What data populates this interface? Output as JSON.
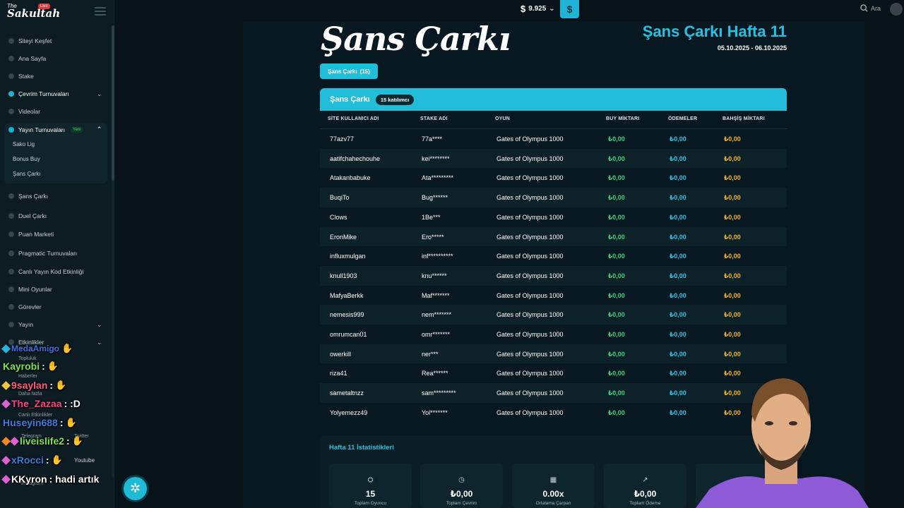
{
  "brand": {
    "top": "The",
    "name": "Sakultah",
    "live_badge": "Live"
  },
  "topbar": {
    "currency_symbol": "$",
    "balance": "9.925",
    "search_label": "Ara"
  },
  "sidebar": {
    "items": [
      {
        "label": "Siteyi Keşfet"
      },
      {
        "label": "Ana Sayfa"
      },
      {
        "label": "Stake"
      },
      {
        "label": "Çevrim Turnuvaları"
      },
      {
        "label": "Videolar"
      },
      {
        "label": "Yayın Turnuvaları",
        "badge": "Yeni"
      },
      {
        "label": "Şans Çarkı"
      },
      {
        "label": "Duel Çarkı"
      },
      {
        "label": "Puan Marketi"
      },
      {
        "label": "Pragmatic Turnuvaları"
      },
      {
        "label": "Canlı Yayın Kod Etkinliği"
      },
      {
        "label": "Mini Oyunlar"
      },
      {
        "label": "Görevler"
      },
      {
        "label": "Yayın"
      },
      {
        "label": "Etkinlikler"
      }
    ],
    "sub_items": [
      "Sako Lig",
      "Bonus Buy",
      "Şans Çarkı"
    ],
    "lower_items": [
      "Topluluk",
      "Haberler",
      "Daha fazla",
      "Canlı Etkinlikler",
      "Telegram",
      "Twitter",
      "Youtube",
      "Instagram"
    ]
  },
  "chat": [
    {
      "user": "MedaAmigo",
      "message": "",
      "color": "#3f6fe0"
    },
    {
      "user": "Kayrobi",
      "message": ":",
      "color": "#7ee24a"
    },
    {
      "user": "9saylan",
      "message": ":",
      "color": "#ff5b7a"
    },
    {
      "user": "The_Zazaa",
      "message": ": :D",
      "color": "#ff3f7f"
    },
    {
      "user": "Huseyin688",
      "message": ":",
      "color": "#3b7ddd"
    },
    {
      "user": "liveislife2",
      "message": ":",
      "color": "#7ee24a"
    },
    {
      "user": "xRocci",
      "message": ":",
      "color": "#3b7ddd"
    },
    {
      "user": "KKyron",
      "message": ": hadi artık",
      "color": "#ffffff"
    }
  ],
  "main": {
    "title": "Şans Çarkı",
    "week_title": "Şans Çarkı Hafta 11",
    "week_dates": "05.10.2025 - 06.10.2025",
    "tab": {
      "label": "Şans Çarkı",
      "count": "(15)"
    },
    "table": {
      "title": "Şans Çarkı",
      "participants": "15 katılımcı",
      "columns": [
        "SİTE KULLANICI ADI",
        "STAKE ADI",
        "OYUN",
        "BUY MİKTARI",
        "ÖDEMELER",
        "BAHŞİŞ MİKTARI"
      ],
      "rows": [
        [
          "77azv77",
          "77a****",
          "Gates of Olympus 1000",
          "₺0,00",
          "₺0,00",
          "₺0,00"
        ],
        [
          "aatifchahechouhe",
          "kei********",
          "Gates of Olympus 1000",
          "₺0,00",
          "₺0,00",
          "₺0,00"
        ],
        [
          "Atakanbabuke",
          "Ata*********",
          "Gates of Olympus 1000",
          "₺0,00",
          "₺0,00",
          "₺0,00"
        ],
        [
          "BuqiTo",
          "Bug******",
          "Gates of Olympus 1000",
          "₺0,00",
          "₺0,00",
          "₺0,00"
        ],
        [
          "Clows",
          "1Be***",
          "Gates of Olympus 1000",
          "₺0,00",
          "₺0,00",
          "₺0,00"
        ],
        [
          "EronMike",
          "Ero*****",
          "Gates of Olympus 1000",
          "₺0,00",
          "₺0,00",
          "₺0,00"
        ],
        [
          "influxmulgan",
          "inf**********",
          "Gates of Olympus 1000",
          "₺0,00",
          "₺0,00",
          "₺0,00"
        ],
        [
          "knull1903",
          "knu******",
          "Gates of Olympus 1000",
          "₺0,00",
          "₺0,00",
          "₺0,00"
        ],
        [
          "MafyaBerkk",
          "Maf*******",
          "Gates of Olympus 1000",
          "₺0,00",
          "₺0,00",
          "₺0,00"
        ],
        [
          "nemesis999",
          "nem*******",
          "Gates of Olympus 1000",
          "₺0,00",
          "₺0,00",
          "₺0,00"
        ],
        [
          "omrumcan01",
          "omr*******",
          "Gates of Olympus 1000",
          "₺0,00",
          "₺0,00",
          "₺0,00"
        ],
        [
          "owerkill",
          "ner***",
          "Gates of Olympus 1000",
          "₺0,00",
          "₺0,00",
          "₺0,00"
        ],
        [
          "riza41",
          "Rea******",
          "Gates of Olympus 1000",
          "₺0,00",
          "₺0,00",
          "₺0,00"
        ],
        [
          "sametaltnzz",
          "sam*********",
          "Gates of Olympus 1000",
          "₺0,00",
          "₺0,00",
          "₺0,00"
        ],
        [
          "Yolyemezz49",
          "Yol*******",
          "Gates of Olympus 1000",
          "₺0,00",
          "₺0,00",
          "₺0,00"
        ]
      ]
    },
    "stats": {
      "title": "Hafta 11 İstatistikleri",
      "cards": [
        {
          "icon": "users-icon",
          "value": "15",
          "label": "Toplam Oyuncu"
        },
        {
          "icon": "stopwatch-icon",
          "value": "₺0,00",
          "label": "Toplam Çevrim"
        },
        {
          "icon": "calculator-icon",
          "value": "0.00x",
          "label": "Ortalama Çarpan"
        },
        {
          "icon": "chart-icon",
          "value": "₺0,00",
          "label": "Toplam Ödeme"
        }
      ]
    }
  },
  "colors": {
    "accent": "#22bdd9",
    "green": "#3ed07f",
    "cyan": "#2ec3e6",
    "gold": "#f0b42a"
  }
}
